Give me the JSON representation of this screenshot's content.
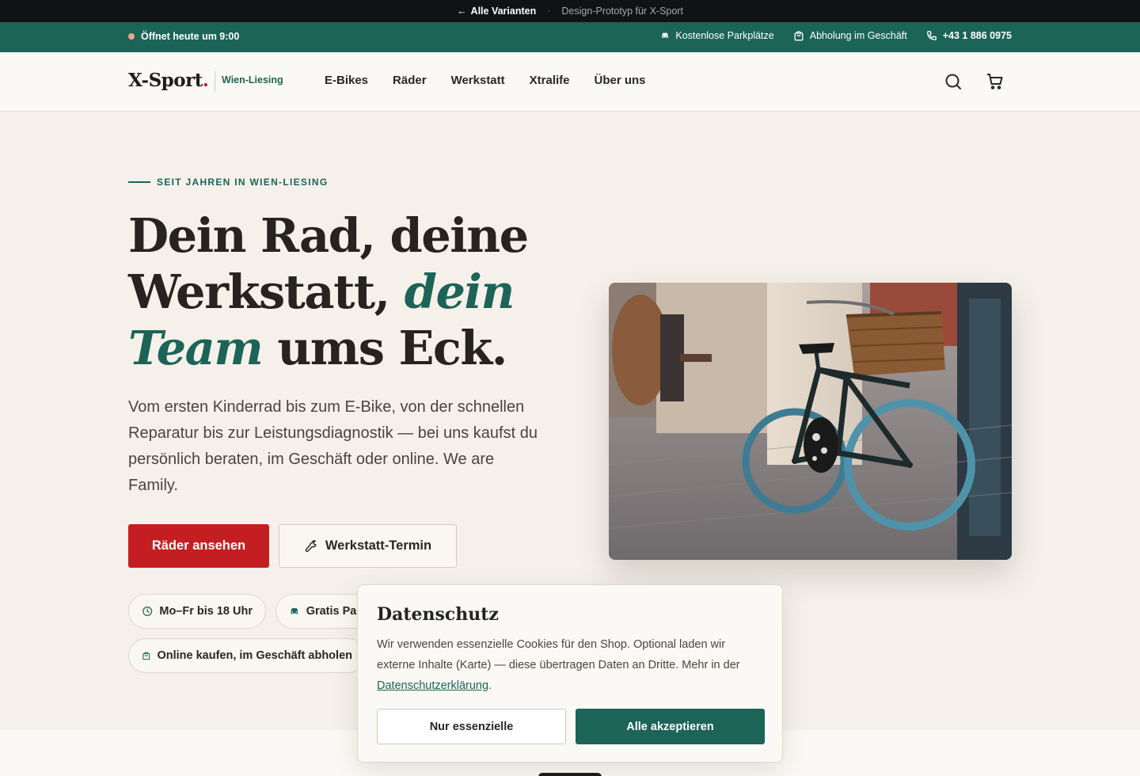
{
  "protobar": {
    "back_label": "Alle Varianten",
    "separator": "·",
    "prototype_label": "Design-Prototyp für X-Sport"
  },
  "infobar": {
    "open_label": "Öffnet heute um 9:00",
    "parking": "Kostenlose Parkplätze",
    "pickup": "Abholung im Geschäft",
    "phone": "+43 1 886 0975"
  },
  "header": {
    "logo_text": "X-Sport",
    "logo_dot": ".",
    "location": "Wien-Liesing",
    "nav": [
      "E-Bikes",
      "Räder",
      "Werkstatt",
      "Xtralife",
      "Über uns"
    ]
  },
  "hero": {
    "eyebrow": "SEIT JAHREN IN WIEN-LIESING",
    "headline_part1": "Dein Rad, deine Werkstatt, ",
    "headline_accent": "dein Team",
    "headline_part2": " ums Eck.",
    "lead": "Vom ersten Kinderrad bis zum E-Bike, von der schnellen Reparatur bis zur Leistungsdiagnostik — bei uns kaufst du persönlich beraten, im Geschäft oder online. We are Family.",
    "primary_button": "Räder ansehen",
    "secondary_button": "Werkstatt-Termin",
    "chips": [
      "Mo–Fr bis 18 Uhr",
      "Gratis Parken",
      "Online kaufen, im Geschäft abholen"
    ]
  },
  "cookie": {
    "title": "Datenschutz",
    "text_before": "Wir verwenden essenzielle Cookies für den Shop. Optional laden wir externe Inhalte (Karte) — diese übertragen Daten an Dritte. Mehr in der ",
    "link": "Datenschutzerklärung",
    "text_after": ".",
    "essential_button": "Nur essenzielle",
    "accept_button": "Alle akzeptieren"
  },
  "colors": {
    "brand_green": "#1c6457",
    "brand_red": "#c41e22",
    "background": "#f5f1ea"
  }
}
